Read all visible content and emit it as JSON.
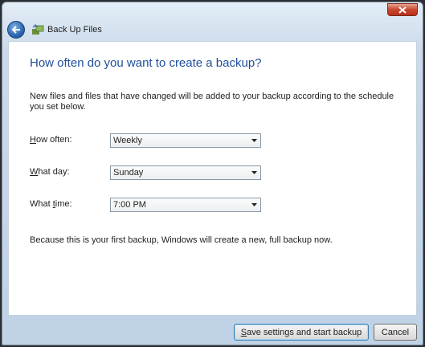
{
  "window": {
    "title": "Back Up Files",
    "close_icon": "close-icon",
    "back_icon": "back-arrow-icon",
    "app_icon": "backup-icon"
  },
  "page": {
    "heading": "How often do you want to create a backup?",
    "intro": "New files and files that have changed will be added to your backup according to the schedule you set below.",
    "note": "Because this is your first backup, Windows will create a new, full backup now."
  },
  "schedule": {
    "how_often": {
      "label_prefix": "H",
      "label_rest": "ow often:",
      "value": "Weekly"
    },
    "what_day": {
      "label_prefix": "W",
      "label_rest": "hat day:",
      "value": "Sunday"
    },
    "what_time": {
      "label_before": "What ",
      "label_accel": "t",
      "label_after": "ime:",
      "value": "7:00 PM"
    }
  },
  "buttons": {
    "save_prefix": "S",
    "save_rest": "ave settings and start backup",
    "cancel": "Cancel"
  },
  "colors": {
    "heading": "#1f4e9c",
    "chrome": "#bfd2e6",
    "close": "#c7472f"
  }
}
